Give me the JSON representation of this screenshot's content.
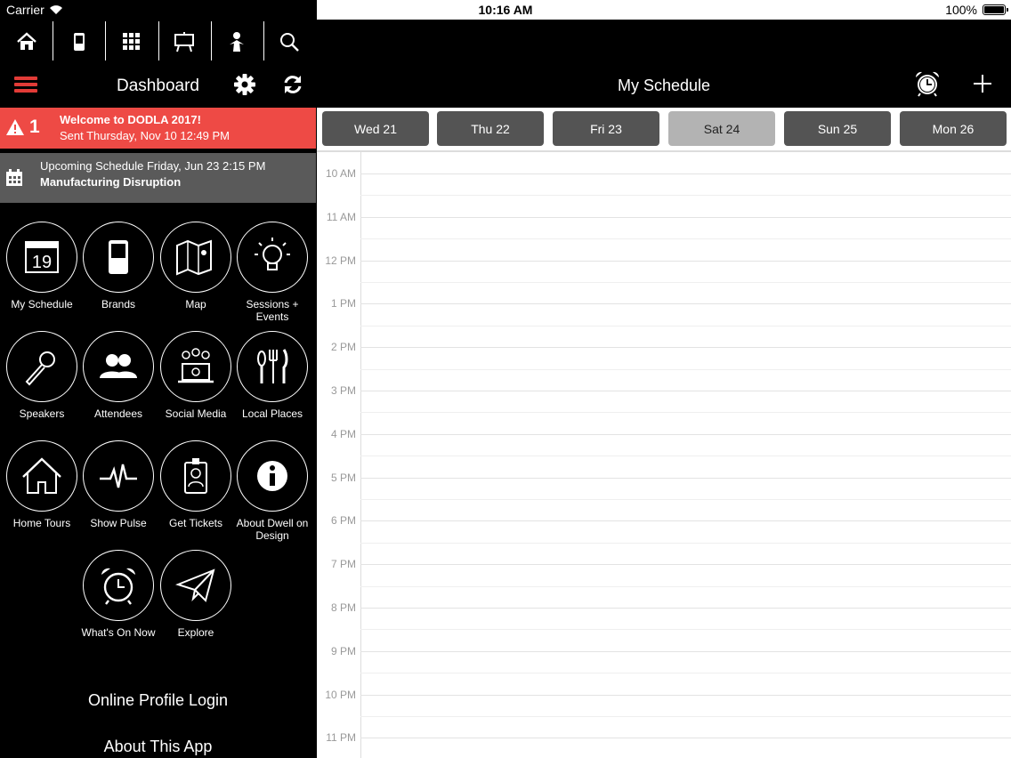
{
  "status": {
    "carrier": "Carrier",
    "time": "10:16 AM",
    "battery": "100%"
  },
  "left": {
    "toolbar_icons": [
      "home-icon",
      "phone-icon",
      "qr-code-icon",
      "presentation-board-icon",
      "speaker-person-icon",
      "search-icon"
    ],
    "title": "Dashboard",
    "alert": {
      "count": "1",
      "title": "Welcome to DODLA 2017!",
      "sent": "Sent Thursday, Nov 10 12:49 PM"
    },
    "upcoming": {
      "line1": "Upcoming Schedule Friday, Jun 23 2:15 PM",
      "line2": "Manufacturing Disruption"
    },
    "tiles": [
      {
        "label": "My Schedule",
        "icon": "calendar-19-icon"
      },
      {
        "label": "Brands",
        "icon": "phone-icon"
      },
      {
        "label": "Map",
        "icon": "map-icon"
      },
      {
        "label": "Sessions + Events",
        "icon": "lightbulb-icon"
      },
      {
        "label": "Speakers",
        "icon": "microphone-icon"
      },
      {
        "label": "Attendees",
        "icon": "people-icon"
      },
      {
        "label": "Social Media",
        "icon": "laptop-social-icon"
      },
      {
        "label": "Local Places",
        "icon": "utensils-icon"
      },
      {
        "label": "Home Tours",
        "icon": "house-icon"
      },
      {
        "label": "Show Pulse",
        "icon": "pulse-icon"
      },
      {
        "label": "Get Tickets",
        "icon": "badge-icon"
      },
      {
        "label": "About Dwell on Design",
        "icon": "info-icon"
      },
      {
        "label": "What's On Now",
        "icon": "alarm-clock-icon"
      },
      {
        "label": "Explore",
        "icon": "paper-plane-icon"
      }
    ],
    "links": {
      "profile": "Online Profile Login",
      "about": "About This App"
    }
  },
  "right": {
    "title": "My Schedule",
    "days": [
      {
        "label": "Wed 21",
        "selected": false
      },
      {
        "label": "Thu 22",
        "selected": false
      },
      {
        "label": "Fri 23",
        "selected": false
      },
      {
        "label": "Sat 24",
        "selected": true
      },
      {
        "label": "Sun 25",
        "selected": false
      },
      {
        "label": "Mon 26",
        "selected": false
      }
    ],
    "hours": [
      "10 AM",
      "11 AM",
      "12 PM",
      "1 PM",
      "2 PM",
      "3 PM",
      "4 PM",
      "5 PM",
      "6 PM",
      "7 PM",
      "8 PM",
      "9 PM",
      "10 PM",
      "11 PM"
    ]
  },
  "colors": {
    "accent": "#ee4a45",
    "hamburger": "#e23b37",
    "upcoming_bg": "#5a5a5a",
    "day_button": "#545454",
    "day_selected": "#b3b3b3"
  }
}
